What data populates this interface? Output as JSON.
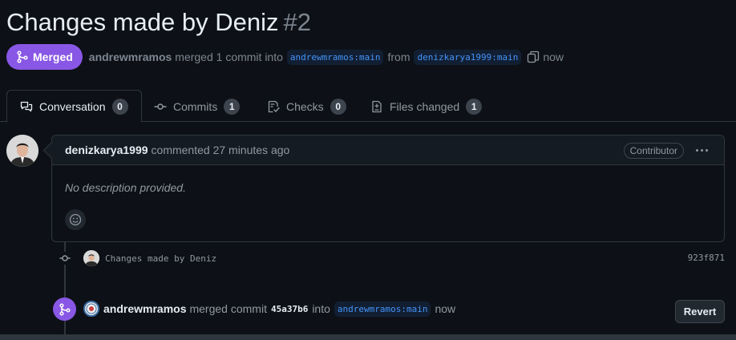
{
  "pr": {
    "title": "Changes made by Deniz",
    "number": "#2",
    "status_label": "Merged",
    "merger": "andrewmramos",
    "merge_text": "merged 1 commit into",
    "base_branch": "andrewmramos:main",
    "from_text": "from",
    "head_branch": "denizkarya1999:main",
    "time": "now"
  },
  "tabs": [
    {
      "label": "Conversation",
      "count": "0",
      "icon": "comment-discussion-icon"
    },
    {
      "label": "Commits",
      "count": "1",
      "icon": "git-commit-icon"
    },
    {
      "label": "Checks",
      "count": "0",
      "icon": "checklist-icon"
    },
    {
      "label": "Files changed",
      "count": "1",
      "icon": "file-diff-icon"
    }
  ],
  "comment": {
    "author": "denizkarya1999",
    "action": "commented 27 minutes ago",
    "badge": "Contributor",
    "body": "No description provided."
  },
  "commit": {
    "message": "Changes made by Deniz",
    "sha": "923f871"
  },
  "merge_event": {
    "author": "andrewmramos",
    "text": "merged commit",
    "sha": "45a37b6",
    "into": "into",
    "branch": "andrewmramos:main",
    "time": "now",
    "revert_label": "Revert"
  },
  "colors": {
    "background": "#0d1117",
    "merged": "#8957e5",
    "link": "#4493f8",
    "border": "#30363d"
  }
}
